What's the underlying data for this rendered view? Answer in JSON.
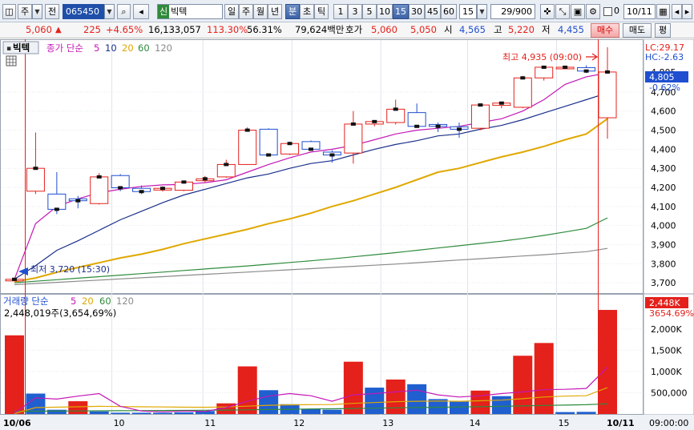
{
  "toolbar": {
    "code": "065450",
    "stock_name": "빅텍",
    "badge": "신",
    "menu1": "주",
    "menu2": "전",
    "periods": [
      "일",
      "주",
      "월",
      "년",
      "분",
      "초",
      "틱"
    ],
    "active_period": "분",
    "intervals": [
      "1",
      "3",
      "5",
      "10",
      "15",
      "30",
      "45",
      "60"
    ],
    "active_interval": "15",
    "interval_value": "15",
    "page": "29/900",
    "checkbox_value": "0",
    "date": "10/11"
  },
  "quote": {
    "price": "5,060",
    "change": "225",
    "change_pct": "+4.65%",
    "volume": "16,133,057",
    "vol_ratio": "113.30%",
    "turnover": "56.31%",
    "amount": "79,624백만",
    "ask_label": "호가",
    "ask": "5,060",
    "bid": "5,050",
    "open_label": "시",
    "open": "4,565",
    "high_label": "고",
    "high": "5,220",
    "low_label": "저",
    "low": "4,455",
    "buy_label": "매수",
    "sell_label": "매도",
    "extra_label": "평"
  },
  "chart_data": [
    {
      "type": "candlestick",
      "title": "빅텍",
      "legend_text": "종가 단순",
      "ma_periods": [
        5,
        10,
        20,
        60,
        120
      ],
      "colors": {
        "up": "#e4211b",
        "down": "#1f4fd0",
        "ma5": "#c418b6",
        "ma10": "#1b2f8a",
        "ma20": "#e0a800",
        "ma60": "#2e8b3c",
        "ma120": "#8a8a8a"
      },
      "ylim": [
        3650,
        4960
      ],
      "y_ticks": [
        "3,700",
        "3,800",
        "3,900",
        "4,000",
        "4,100",
        "4,200",
        "4,300",
        "4,400",
        "4,500",
        "4,600",
        "4,700",
        "4,805"
      ],
      "x_labels": [
        "10/06",
        "10",
        "11",
        "12",
        "13",
        "14",
        "15",
        "10/11"
      ],
      "time_label": "09:00:00",
      "high_annotation": "최고 4,935 (09:00)",
      "low_annotation": "최저 3,720 (15:30)",
      "right_labels": {
        "lc": "LC:29.17",
        "hc": "HC:-2.63",
        "price": "4,805",
        "pct": "-0.62%"
      },
      "candles": [
        {
          "o": 3715,
          "h": 3722,
          "l": 3711,
          "c": 3718
        },
        {
          "o": 4180,
          "h": 4488,
          "l": 4165,
          "c": 4300
        },
        {
          "o": 4165,
          "h": 4280,
          "l": 4060,
          "c": 4085
        },
        {
          "o": 4140,
          "h": 4155,
          "l": 4090,
          "c": 4130
        },
        {
          "o": 4115,
          "h": 4275,
          "l": 4110,
          "c": 4255
        },
        {
          "o": 4262,
          "h": 4270,
          "l": 4180,
          "c": 4198
        },
        {
          "o": 4195,
          "h": 4210,
          "l": 4165,
          "c": 4178
        },
        {
          "o": 4186,
          "h": 4205,
          "l": 4178,
          "c": 4195
        },
        {
          "o": 4185,
          "h": 4235,
          "l": 4180,
          "c": 4228
        },
        {
          "o": 4235,
          "h": 4260,
          "l": 4225,
          "c": 4245
        },
        {
          "o": 4255,
          "h": 4345,
          "l": 4250,
          "c": 4320
        },
        {
          "o": 4320,
          "h": 4515,
          "l": 4318,
          "c": 4500
        },
        {
          "o": 4505,
          "h": 4510,
          "l": 4380,
          "c": 4370
        },
        {
          "o": 4375,
          "h": 4440,
          "l": 4370,
          "c": 4430
        },
        {
          "o": 4440,
          "h": 4446,
          "l": 4400,
          "c": 4400
        },
        {
          "o": 4385,
          "h": 4395,
          "l": 4330,
          "c": 4370
        },
        {
          "o": 4380,
          "h": 4600,
          "l": 4325,
          "c": 4532
        },
        {
          "o": 4532,
          "h": 4550,
          "l": 4520,
          "c": 4545
        },
        {
          "o": 4540,
          "h": 4660,
          "l": 4530,
          "c": 4610
        },
        {
          "o": 4592,
          "h": 4640,
          "l": 4520,
          "c": 4520
        },
        {
          "o": 4530,
          "h": 4540,
          "l": 4490,
          "c": 4520
        },
        {
          "o": 4518,
          "h": 4540,
          "l": 4460,
          "c": 4505
        },
        {
          "o": 4510,
          "h": 4640,
          "l": 4500,
          "c": 4632
        },
        {
          "o": 4630,
          "h": 4650,
          "l": 4615,
          "c": 4642
        },
        {
          "o": 4620,
          "h": 4785,
          "l": 4615,
          "c": 4774
        },
        {
          "o": 4774,
          "h": 4830,
          "l": 4760,
          "c": 4830
        },
        {
          "o": 4830,
          "h": 4835,
          "l": 4825,
          "c": 4830
        },
        {
          "o": 4828,
          "h": 4840,
          "l": 4800,
          "c": 4810
        },
        {
          "o": 4565,
          "h": 4935,
          "l": 4455,
          "c": 4805
        }
      ],
      "ma5": [
        3718,
        4010,
        4100,
        4140,
        4172,
        4190,
        4205,
        4213,
        4215,
        4225,
        4240,
        4280,
        4320,
        4355,
        4385,
        4400,
        4420,
        4450,
        4480,
        4500,
        4510,
        4520,
        4540,
        4560,
        4600,
        4660,
        4740,
        4780,
        4800
      ],
      "ma10": [
        3718,
        3790,
        3870,
        3920,
        3975,
        4030,
        4075,
        4120,
        4160,
        4190,
        4220,
        4250,
        4270,
        4300,
        4325,
        4340,
        4370,
        4400,
        4425,
        4445,
        4470,
        4480,
        4505,
        4525,
        4555,
        4590,
        4625,
        4660,
        4695
      ],
      "ma20": [
        3705,
        3725,
        3755,
        3780,
        3805,
        3830,
        3850,
        3875,
        3905,
        3930,
        3955,
        3980,
        4010,
        4035,
        4065,
        4100,
        4130,
        4165,
        4200,
        4240,
        4280,
        4300,
        4330,
        4360,
        4385,
        4415,
        4450,
        4480,
        4560
      ],
      "ma60": [
        3700,
        3708,
        3716,
        3724,
        3732,
        3740,
        3748,
        3756,
        3764,
        3772,
        3780,
        3788,
        3797,
        3806,
        3815,
        3825,
        3836,
        3847,
        3858,
        3870,
        3882,
        3894,
        3906,
        3918,
        3932,
        3948,
        3966,
        3985,
        4040
      ],
      "ma120": [
        3690,
        3696,
        3702,
        3708,
        3714,
        3720,
        3726,
        3732,
        3738,
        3744,
        3750,
        3756,
        3762,
        3768,
        3774,
        3780,
        3786,
        3792,
        3798,
        3805,
        3812,
        3819,
        3826,
        3833,
        3840,
        3847,
        3855,
        3863,
        3880
      ]
    },
    {
      "type": "bar",
      "title": "거래량 단순",
      "ma_periods": [
        5,
        20,
        60,
        120
      ],
      "summary": "2,448,019주(3,654,69%)",
      "ylim": [
        0,
        2750000
      ],
      "y_ticks": [
        "500,000",
        "1,000K",
        "1,500K",
        "2,000K"
      ],
      "right_labels": {
        "value": "2,448K",
        "pct": "3654.69%"
      },
      "values": [
        1850000,
        480000,
        100000,
        300000,
        60000,
        30000,
        30000,
        30000,
        40000,
        70000,
        250000,
        1120000,
        560000,
        230000,
        120000,
        100000,
        1230000,
        620000,
        810000,
        700000,
        350000,
        290000,
        550000,
        420000,
        1370000,
        1670000,
        45000,
        50000,
        2448019
      ],
      "up": [
        1,
        0,
        0,
        1,
        0,
        0,
        0,
        0,
        0,
        0,
        1,
        1,
        0,
        0,
        0,
        0,
        1,
        0,
        1,
        0,
        0,
        0,
        1,
        0,
        1,
        1,
        0,
        0,
        1
      ],
      "ma5": [
        20000,
        380000,
        350000,
        420000,
        480000,
        180000,
        70000,
        50000,
        70000,
        60000,
        150000,
        300000,
        420000,
        480000,
        430000,
        300000,
        450000,
        480000,
        520000,
        560000,
        450000,
        400000,
        430000,
        480000,
        520000,
        570000,
        580000,
        600000,
        1100000
      ],
      "ma20": [
        10000,
        150000,
        160000,
        170000,
        180000,
        175000,
        170000,
        165000,
        160000,
        158000,
        165000,
        185000,
        205000,
        215000,
        220000,
        222000,
        250000,
        270000,
        290000,
        300000,
        305000,
        300000,
        310000,
        325000,
        360000,
        400000,
        420000,
        430000,
        620000
      ],
      "ma60": [
        60000,
        65000,
        70000,
        72000,
        75000,
        77000,
        80000,
        82000,
        85000,
        88000,
        92000,
        98000,
        105000,
        112000,
        118000,
        123000,
        130000,
        138000,
        145000,
        152000,
        158000,
        165000,
        172000,
        180000,
        190000,
        202000,
        210000,
        218000,
        240000
      ]
    }
  ]
}
